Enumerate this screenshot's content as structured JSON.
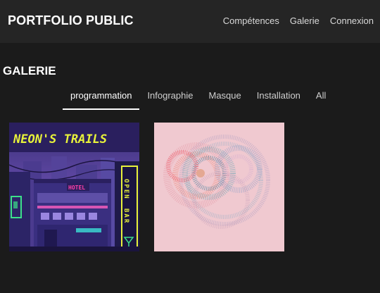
{
  "header": {
    "brand": "PORTFOLIO PUBLIC",
    "nav": [
      "Compétences",
      "Galerie",
      "Connexion"
    ]
  },
  "gallery": {
    "title": "GALERIE",
    "tabs": [
      "programmation",
      "Infographie",
      "Masque",
      "Installation",
      "All"
    ],
    "active_tab": "programmation",
    "items": [
      {
        "name": "neon-trails",
        "title_art": "NEON'S TRAILS",
        "sign_hotel": "HOTEL",
        "sign_open": "OPEN",
        "sign_bar": "BAR"
      },
      {
        "name": "generative-circles"
      }
    ]
  },
  "colors": {
    "background": "#1b1b1b",
    "topbar": "#252525",
    "neon_yellow": "#e8f23a",
    "neon_pink": "#ff3fa8",
    "art_pink_bg": "#f0c9d0"
  }
}
